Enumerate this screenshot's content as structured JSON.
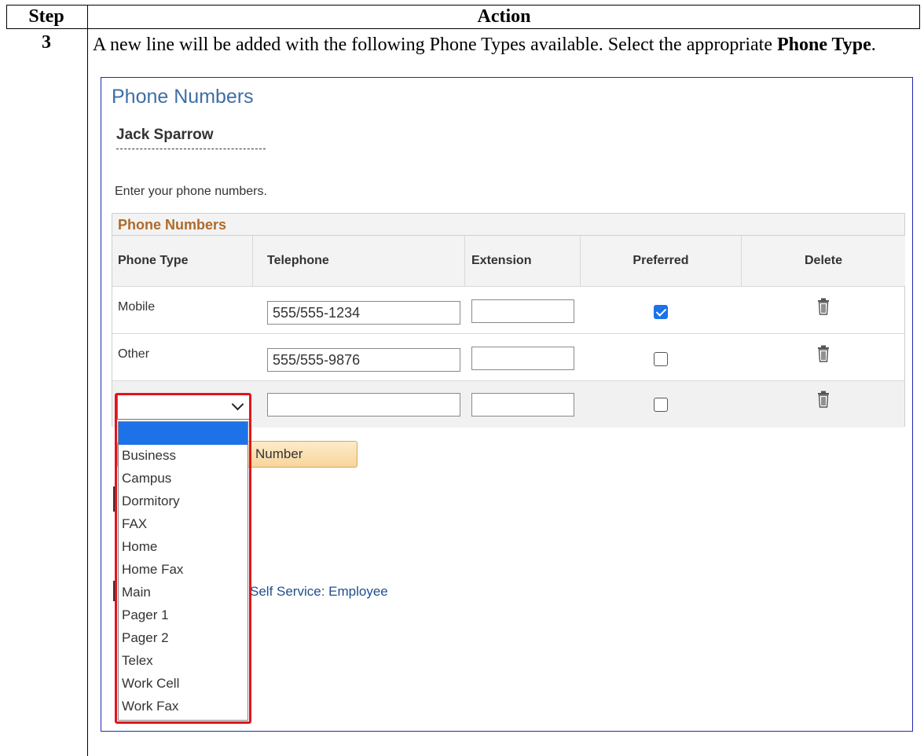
{
  "table": {
    "header_step": "Step",
    "header_action": "Action",
    "step_number": "3",
    "instruction_prefix": "A new line will be added with the following Phone Types available. Select the appropriate ",
    "instruction_bold": "Phone Type",
    "instruction_suffix": "."
  },
  "screen": {
    "title": "Phone Numbers",
    "person_name": "Jack Sparrow",
    "instructions": "Enter your phone numbers.",
    "grid": {
      "caption": "Phone Numbers",
      "columns": [
        "Phone Type",
        "Telephone",
        "Extension",
        "Preferred",
        "Delete"
      ],
      "rows": [
        {
          "phone_type": "Mobile",
          "telephone": "555/555-1234",
          "extension": "",
          "preferred": true
        },
        {
          "phone_type": "Other",
          "telephone": "555/555-9876",
          "extension": "",
          "preferred": false
        },
        {
          "phone_type": "",
          "telephone": "",
          "extension": "",
          "preferred": false
        }
      ]
    },
    "add_button_visible_label": "Number",
    "nav_link_visible": "Self Service: Employee",
    "dropdown": {
      "selected": "",
      "options": [
        "",
        "Business",
        "Campus",
        "Dormitory",
        "FAX",
        "Home",
        "Home Fax",
        "Main",
        "Pager 1",
        "Pager 2",
        "Telex",
        "Work Cell",
        "Work Fax"
      ]
    },
    "icons": {
      "delete": "trash-icon",
      "dropdown": "chevron-down-icon"
    },
    "colors": {
      "title": "#3f6ea5",
      "caption": "#b06a2a",
      "highlight": "#e2141b",
      "selected_option": "#1e72e8",
      "checkbox_checked": "#1a73e8",
      "link": "#1f4e8c"
    }
  }
}
